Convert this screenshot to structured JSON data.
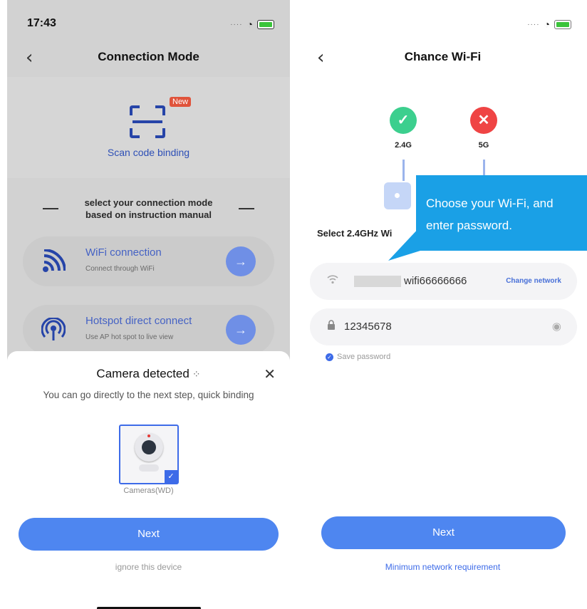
{
  "left_screen": {
    "status_time": "17:43",
    "nav_title": "Connection Mode",
    "scan": {
      "label": "Scan code binding",
      "badge": "New"
    },
    "select_mode_text_line1": "select your connection mode",
    "select_mode_text_line2": "based on instruction manual",
    "modes": [
      {
        "title": "WiFi connection",
        "subtitle": "Connect through WiFi"
      },
      {
        "title": "Hotspot direct connect",
        "subtitle": "Use AP hot spot to live view"
      }
    ],
    "sheet": {
      "title": "Camera detected",
      "subtitle": "You can go directly to the next step, quick binding",
      "camera_label": "Cameras(WD)",
      "next_label": "Next",
      "ignore_label": "ignore this device"
    }
  },
  "right_screen": {
    "nav_title": "Chance Wi-Fi",
    "band_24": {
      "label": "2.4G",
      "status_color": "#3ccf8e"
    },
    "band_5": {
      "label": "5G",
      "status_color": "#ef4444"
    },
    "select_label": "Select 2.4GHz Wi",
    "wifi_ssid": "wifi66666666",
    "change_network_label": "Change network",
    "password_value": "12345678",
    "save_password_label": "Save password",
    "next_label": "Next",
    "min_requirement_label": "Minimum network requirement"
  },
  "callout": {
    "line1": "Choose your Wi-Fi, and",
    "line2": "enter password.",
    "color": "#1aa0e6"
  },
  "colors": {
    "accent": "#4e86f0",
    "link": "#3d6be8"
  }
}
